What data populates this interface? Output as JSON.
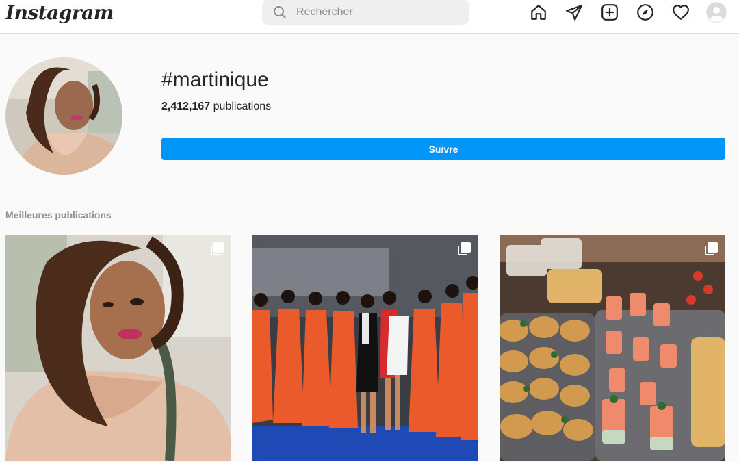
{
  "app": {
    "logo_text": "Instagram"
  },
  "search": {
    "placeholder": "Rechercher",
    "value": ""
  },
  "nav": {
    "icons": [
      "home-icon",
      "direct-icon",
      "new-post-icon",
      "explore-icon",
      "activity-icon",
      "profile-avatar"
    ]
  },
  "header": {
    "hashtag": "#martinique",
    "post_count": "2,412,167",
    "post_count_label": "publications",
    "follow_label": "Suivre"
  },
  "top_posts": {
    "title": "Meilleures publications",
    "posts": [
      {
        "subject": "selfie-woman-curly-hair",
        "multi": true
      },
      {
        "subject": "women-orange-dresses-group",
        "multi": true
      },
      {
        "subject": "catering-buffet-platters",
        "multi": true
      }
    ]
  },
  "colors": {
    "accent": "#0095f6",
    "background": "#fafafa",
    "border": "#dbdbdb",
    "muted_text": "#8e8e8e"
  }
}
